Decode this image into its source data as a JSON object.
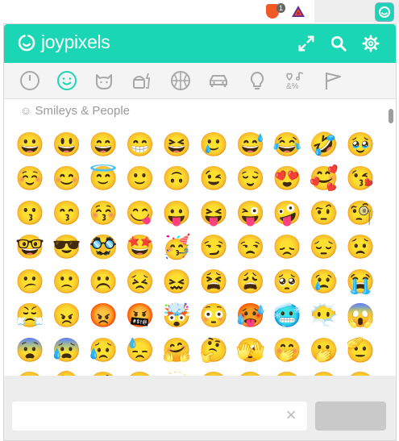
{
  "browser": {
    "extensions": [
      {
        "name": "brave-shields",
        "badge": "1"
      },
      {
        "name": "brave-rewards"
      },
      {
        "name": "joypixels-extension"
      }
    ]
  },
  "header": {
    "logo_text": "joypixels",
    "actions": [
      "expand-icon",
      "search-icon",
      "gear-icon"
    ],
    "brand_color": "#1ad6b5"
  },
  "categories": [
    {
      "name": "recent",
      "icon": "clock-icon",
      "active": false
    },
    {
      "name": "people",
      "icon": "smiley-icon",
      "active": true
    },
    {
      "name": "nature",
      "icon": "cat-icon",
      "active": false
    },
    {
      "name": "food",
      "icon": "food-icon",
      "active": false
    },
    {
      "name": "activity",
      "icon": "ball-icon",
      "active": false
    },
    {
      "name": "travel",
      "icon": "car-icon",
      "active": false
    },
    {
      "name": "objects",
      "icon": "bulb-icon",
      "active": false
    },
    {
      "name": "symbols",
      "icon": "symbols-icon",
      "active": false
    },
    {
      "name": "flags",
      "icon": "flag-icon",
      "active": false
    }
  ],
  "section": {
    "title": "Smileys & People"
  },
  "emoji_rows": [
    [
      "😀",
      "😃",
      "😄",
      "😁",
      "😆",
      "🥲",
      "😅",
      "😂",
      "🤣",
      "🥹"
    ],
    [
      "☺️",
      "😊",
      "😇",
      "🙂",
      "🙃",
      "😉",
      "😌",
      "😍",
      "🥰",
      "😘"
    ],
    [
      "😗",
      "😙",
      "😚",
      "😋",
      "😛",
      "😝",
      "😜",
      "🤪",
      "🤨",
      "🧐"
    ],
    [
      "🤓",
      "😎",
      "🥸",
      "🤩",
      "🥳",
      "😏",
      "😒",
      "😞",
      "😔",
      "😟"
    ],
    [
      "😕",
      "🙁",
      "☹️",
      "😣",
      "😖",
      "😫",
      "😩",
      "🥺",
      "😢",
      "😭"
    ],
    [
      "😤",
      "😠",
      "😡",
      "🤬",
      "🤯",
      "😳",
      "🥵",
      "🥶",
      "😶‍🌫️",
      "😱"
    ],
    [
      "😨",
      "😰",
      "😥",
      "😓",
      "🤗",
      "🤔",
      "🫣",
      "🤭",
      "🫢",
      "🫡"
    ],
    [
      "🤫",
      "🫠",
      "🤥",
      "😶",
      "🫥",
      "😐",
      "🫤",
      "😑",
      "😬",
      "🙄"
    ]
  ],
  "footer": {
    "search_placeholder": "",
    "search_value": "",
    "clear_icon": "×"
  }
}
